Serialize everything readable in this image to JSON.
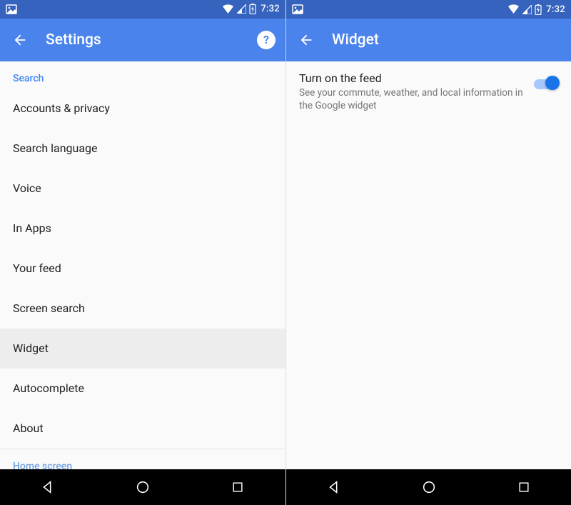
{
  "statusbar": {
    "time": "7:32"
  },
  "left": {
    "title": "Settings",
    "section": "Search",
    "items": [
      {
        "label": "Accounts & privacy"
      },
      {
        "label": "Search language"
      },
      {
        "label": "Voice"
      },
      {
        "label": "In Apps"
      },
      {
        "label": "Your feed"
      },
      {
        "label": "Screen search"
      },
      {
        "label": "Widget"
      },
      {
        "label": "Autocomplete"
      },
      {
        "label": "About"
      }
    ],
    "peek_section": "Home screen"
  },
  "right": {
    "title": "Widget",
    "toggle": {
      "primary": "Turn on the feed",
      "secondary": "See your commute, weather, and local information in the Google widget",
      "on": true
    }
  }
}
